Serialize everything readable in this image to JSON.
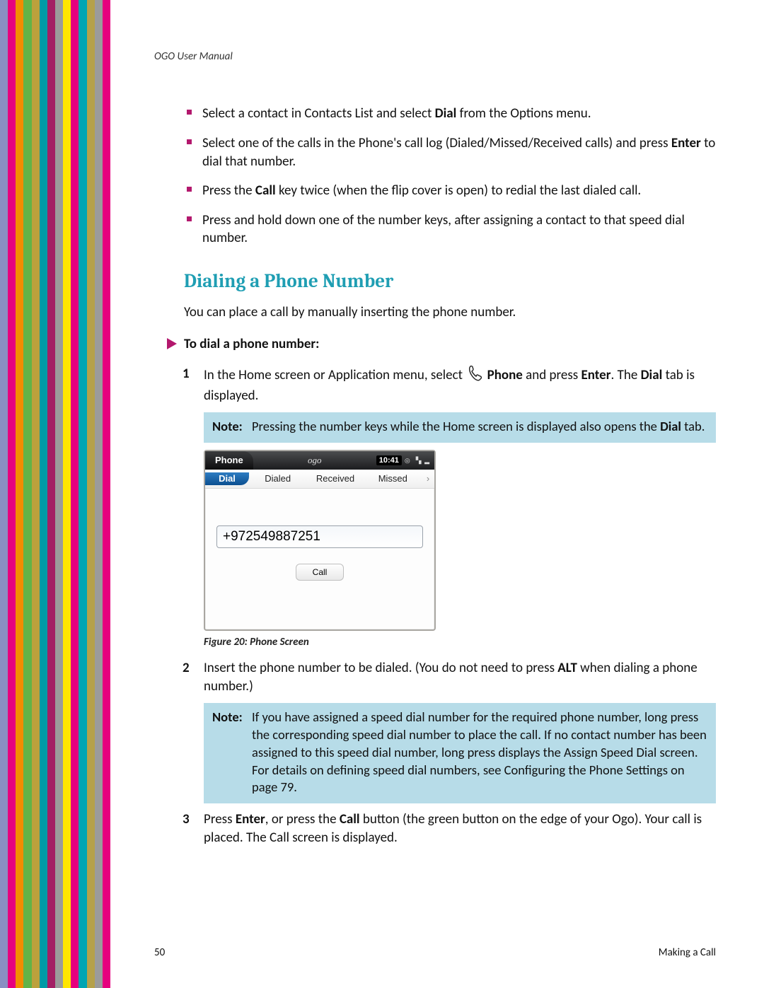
{
  "header": "OGO User Manual",
  "bullets": [
    {
      "pre": "Select a contact in Contacts List and select ",
      "b1": "Dial",
      "post": " from the Options menu."
    },
    {
      "pre": "Select one of the calls in the Phone's call log (Dialed/Missed/Received calls) and press ",
      "b1": "Enter",
      "post": " to dial that number."
    },
    {
      "pre": "Press the ",
      "b1": "Call",
      "post": " key twice (when the flip cover is open) to redial the last dialed call."
    },
    {
      "pre": "Press and hold down one of the number keys, after assigning a contact to that speed dial number.",
      "b1": "",
      "post": ""
    }
  ],
  "section_title": "Dialing a Phone Number",
  "intro": "You can place a call by manually inserting the phone number.",
  "proc_label": "To dial a phone number:",
  "steps": {
    "s1": {
      "num": "1",
      "t1": "In the Home screen or Application menu, select ",
      "b1": "Phone",
      "t2": " and press ",
      "b2": "Enter",
      "t3": ". The ",
      "b3": "Dial",
      "t4": " tab is displayed."
    },
    "s2": {
      "num": "2",
      "t1": "Insert the phone number to be dialed. (You do not need to press ",
      "b1": "ALT",
      "t2": " when dialing a phone number.)"
    },
    "s3": {
      "num": "3",
      "t1": "Press ",
      "b1": "Enter",
      "t2": ", or press the ",
      "b2": "Call",
      "t3": " button (the green button on the edge of your Ogo). Your call is placed. The Call screen is displayed."
    }
  },
  "notes": {
    "label": "Note",
    "n1": {
      "t1": "Pressing the number keys while the Home screen is displayed also opens the ",
      "b1": "Dial",
      "t2": " tab."
    },
    "n2": "If you have assigned a speed dial number for the required phone number, long press the corresponding speed dial number to place the call. If no contact number has been assigned to this speed dial number, long press displays the Assign Speed Dial screen. For details on defining speed dial numbers, see Configuring the Phone Settings on page 79."
  },
  "device": {
    "app": "Phone",
    "logo": "ogo",
    "clock": "10:41",
    "status": "◎ ▝▖▂",
    "tabs": {
      "dial": "Dial",
      "dialed": "Dialed",
      "received": "Received",
      "missed": "Missed",
      "more": "›"
    },
    "number": "+972549887251",
    "call": "Call"
  },
  "fig_caption": "Figure 20: Phone Screen",
  "footer": {
    "page": "50",
    "section": "Making a Call"
  },
  "stripes": [
    "#8a8ec2",
    "#e6007e",
    "#f28c00",
    "#63b347",
    "#bca13c",
    "#009aa6",
    "#a31f64",
    "#9b9b9b",
    "#ffe600",
    "#e6007e",
    "#00a5b3",
    "#b5a14a",
    "#9b9b9b",
    "#e6007e"
  ]
}
